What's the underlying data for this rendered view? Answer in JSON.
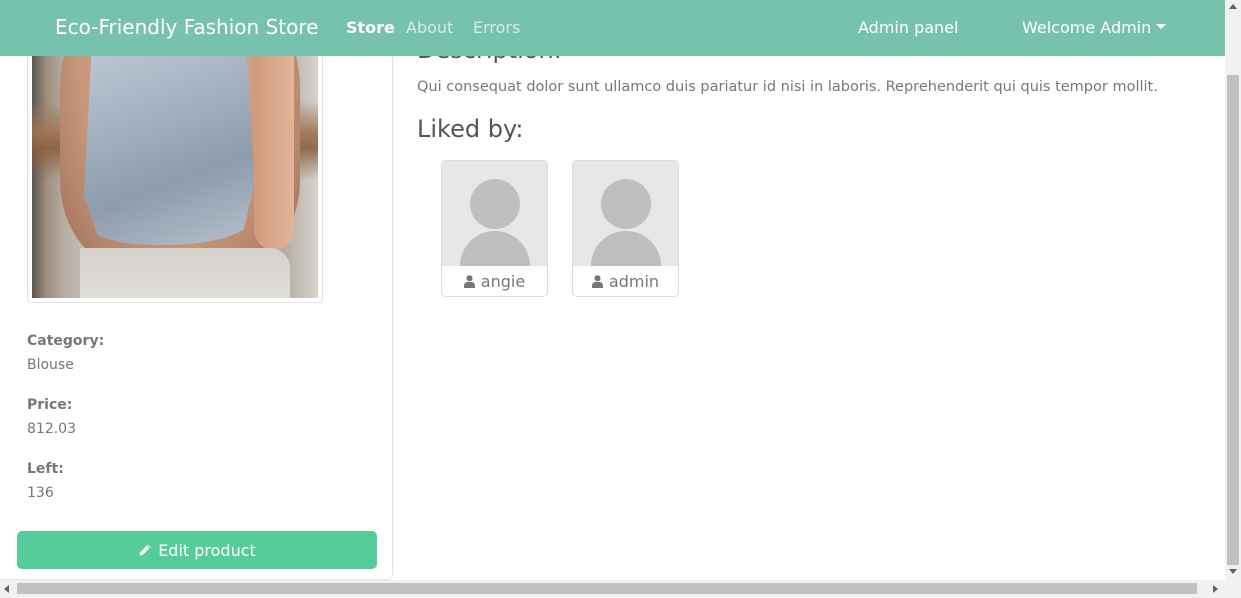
{
  "navbar": {
    "brand": "Eco-Friendly Fashion Store",
    "links": [
      {
        "label": "Store",
        "active": true
      },
      {
        "label": "About",
        "active": false
      },
      {
        "label": "Errors",
        "active": false
      }
    ],
    "admin_panel": "Admin panel",
    "welcome": "Welcome Admin",
    "bg_color": "#77c2ad"
  },
  "product": {
    "image_icon": "product-photo",
    "category_label": "Category:",
    "category": "Blouse",
    "price_label": "Price:",
    "price": "812.03",
    "left_label": "Left:",
    "left": "136",
    "edit_label": "Edit product",
    "edit_icon": "pencil-icon",
    "button_color": "#55cc99"
  },
  "description": {
    "heading": "Description:",
    "text": "Qui consequat dolor sunt ullamco duis pariatur id nisi in laboris. Reprehenderit qui quis tempor mollit."
  },
  "liked_by": {
    "heading": "Liked by:",
    "users": [
      {
        "name": "angie",
        "icon": "user-icon"
      },
      {
        "name": "admin",
        "icon": "user-icon"
      }
    ]
  }
}
